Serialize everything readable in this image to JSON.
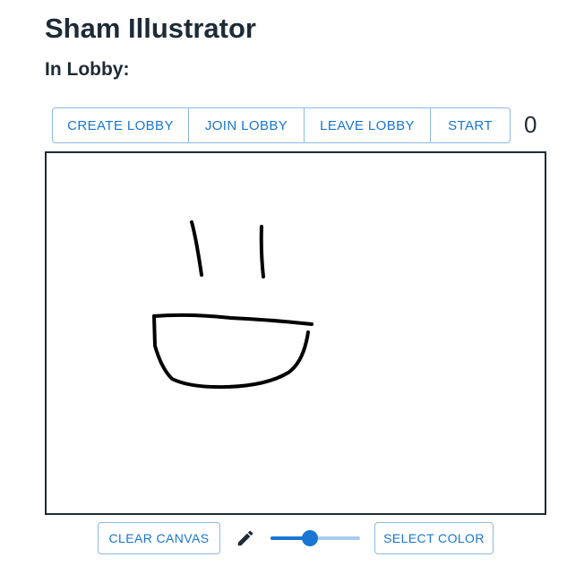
{
  "header": {
    "title": "Sham Illustrator",
    "lobby_status": "In Lobby:"
  },
  "toolbar": {
    "create_label": "CREATE LOBBY",
    "join_label": "JOIN LOBBY",
    "leave_label": "LEAVE LOBBY",
    "start_label": "START",
    "counter": "0"
  },
  "controls": {
    "clear_label": "CLEAR CANVAS",
    "pencil_icon": "pencil-icon",
    "brush_size_fraction": 0.44,
    "select_color_label": "SELECT COLOR"
  },
  "colors": {
    "accent": "#1976d2",
    "heading": "#1e2b37",
    "stroke": "#000000"
  }
}
